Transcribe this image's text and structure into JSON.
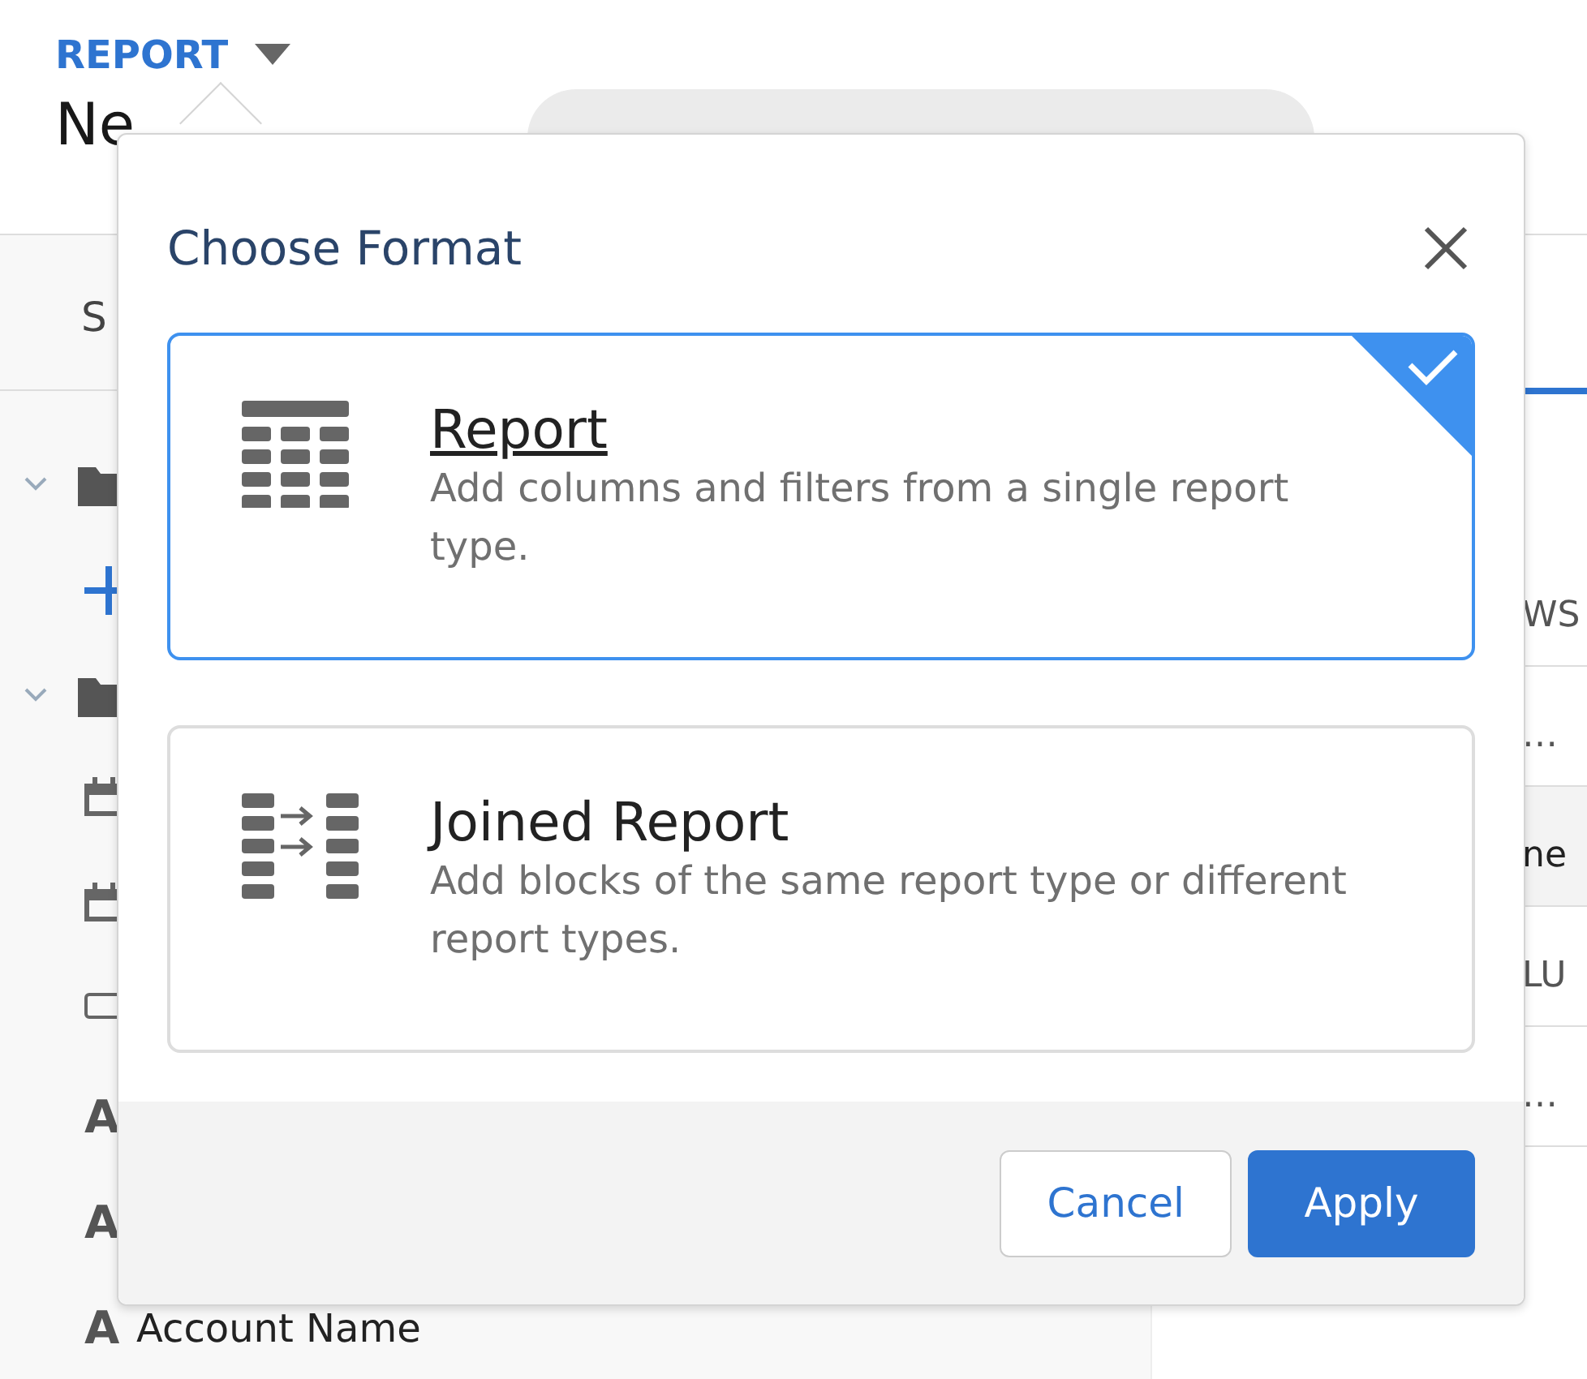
{
  "header": {
    "object_type": "REPORT",
    "title": "Ne"
  },
  "sidebar": {
    "tab": "S",
    "items": [
      {
        "kind": "folder",
        "expanded": true
      },
      {
        "kind": "add"
      },
      {
        "kind": "folder",
        "expanded": true
      },
      {
        "kind": "date"
      },
      {
        "kind": "date"
      },
      {
        "kind": "picklist"
      },
      {
        "kind": "text",
        "glyph": "A"
      },
      {
        "kind": "text",
        "glyph": "A"
      },
      {
        "kind": "text",
        "glyph": "A",
        "label": "Account Name"
      }
    ]
  },
  "preview": {
    "rows": [
      {
        "kind": "plain",
        "text": "WS"
      },
      {
        "kind": "plain",
        "text": "…"
      },
      {
        "kind": "header",
        "text": "ne"
      },
      {
        "kind": "plain",
        "text": "LU"
      },
      {
        "kind": "plain",
        "text": "…"
      }
    ]
  },
  "dialog": {
    "title": "Choose Format",
    "formats": [
      {
        "kind": "report",
        "name": "Report",
        "description": "Add columns and filters from a single report type.",
        "selected": true
      },
      {
        "kind": "joined",
        "name": "Joined Report",
        "description": "Add blocks of the same report type or different report types.",
        "selected": false
      }
    ],
    "buttons": [
      {
        "kind": "secondary",
        "label": "Cancel"
      },
      {
        "kind": "primary",
        "label": "Apply"
      }
    ]
  }
}
